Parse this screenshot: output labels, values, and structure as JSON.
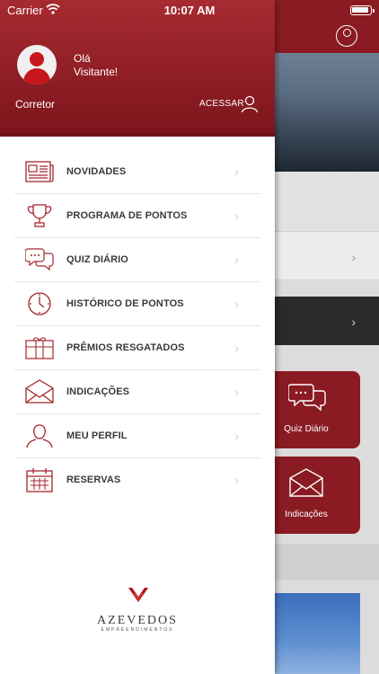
{
  "status_bar": {
    "carrier": "Carrier",
    "time": "10:07 AM"
  },
  "drawer": {
    "greeting_line1": "Olá",
    "greeting_line2": "Visitante!",
    "role": "Corretor",
    "access_label": "ACESSAR",
    "menu": [
      {
        "label": "NOVIDADES",
        "icon": "newspaper-icon"
      },
      {
        "label": "PROGRAMA DE PONTOS",
        "icon": "trophy-icon"
      },
      {
        "label": "QUIZ DIÁRIO",
        "icon": "chat-bubbles-icon"
      },
      {
        "label": "HISTÓRICO DE PONTOS",
        "icon": "clock-icon"
      },
      {
        "label": "PRÊMIOS RESGATADOS",
        "icon": "gift-icon"
      },
      {
        "label": "INDICAÇÕES",
        "icon": "envelope-icon"
      },
      {
        "label": "MEU PERFIL",
        "icon": "user-icon"
      },
      {
        "label": "RESERVAS",
        "icon": "calendar-icon"
      }
    ],
    "logo_name": "AZEVEDOS",
    "logo_sub": "EMPREENDIMENTOS"
  },
  "background": {
    "tile_quiz": "Quiz Diário",
    "tile_indicacoes": "Indicações"
  },
  "colors": {
    "brand_red": "#8e1d24",
    "icon_red": "#a3262d"
  }
}
